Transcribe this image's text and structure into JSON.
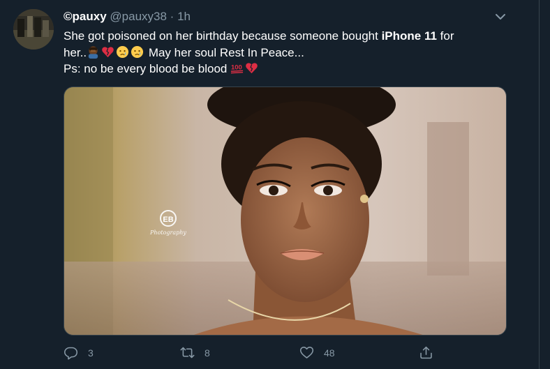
{
  "tweet": {
    "display_name": "©pauxy",
    "handle": "@pauxy38",
    "separator": "·",
    "time": "1h",
    "line1_pre": "She got poisoned on her birthday because someone bought ",
    "line1_bold": "iPhone 11",
    "line1_post": " for",
    "line2_pre": "her..",
    "line2_post": " May her soul Rest In Peace...",
    "line3_pre": "Ps: no be every blood be blood ",
    "emojis_line2": [
      "person-facepalming-emoji",
      "broken-heart-emoji",
      "crying-face-emoji",
      "crying-face-emoji"
    ],
    "emojis_line3": [
      "hundred-points-emoji",
      "broken-heart-emoji"
    ],
    "media": {
      "watermark_logo": "EB",
      "watermark_script": "Photography"
    }
  },
  "actions": {
    "reply_count": "3",
    "retweet_count": "8",
    "like_count": "48"
  },
  "colors": {
    "background": "#15202b",
    "secondary_text": "#8899a6",
    "border": "#38444d"
  }
}
